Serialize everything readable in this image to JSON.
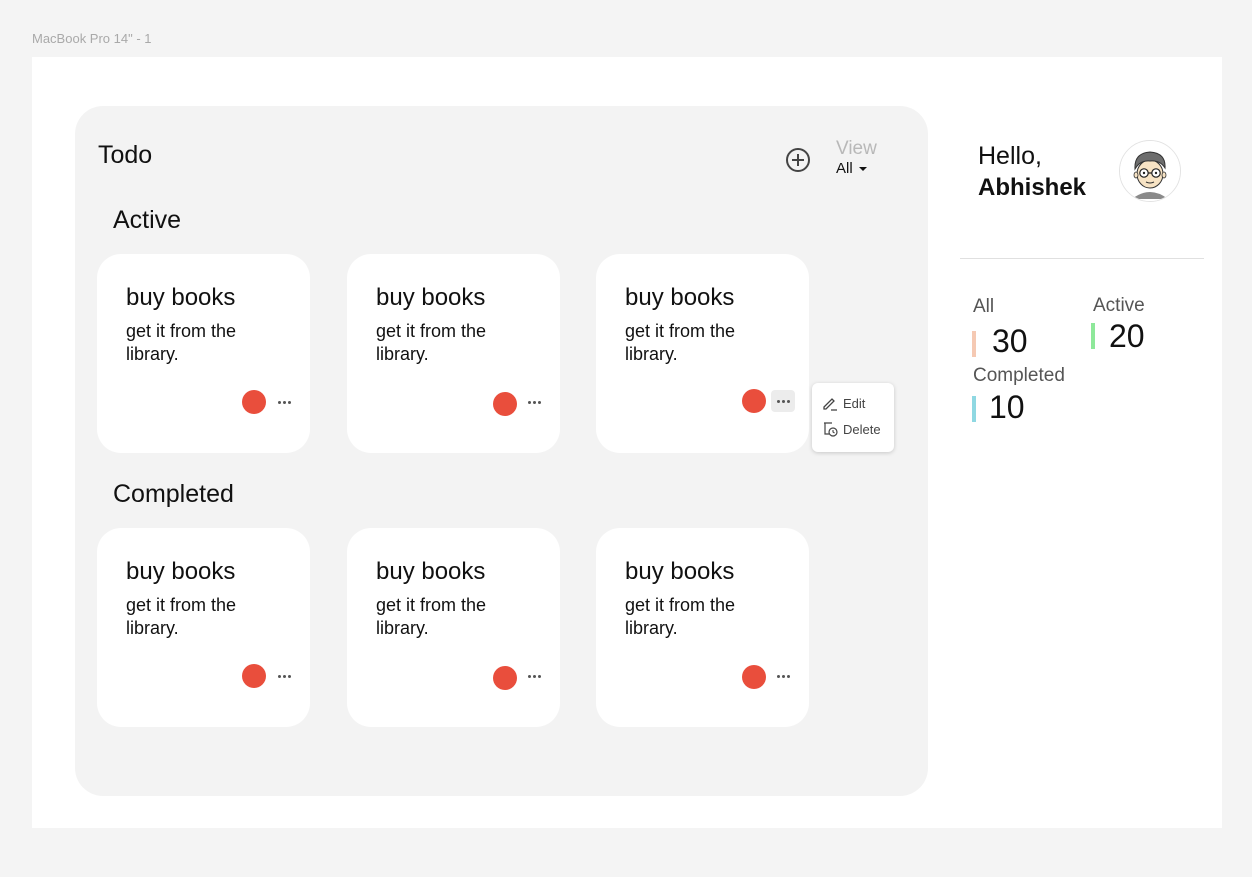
{
  "frame_label": "MacBook Pro 14\" - 1",
  "todo": {
    "title": "Todo",
    "view_label": "View",
    "view_value": "All",
    "sections": [
      {
        "title": "Active",
        "cards": [
          {
            "title": "buy books",
            "desc": "get it from the library."
          },
          {
            "title": "buy books",
            "desc": "get it from the library."
          },
          {
            "title": "buy books",
            "desc": "get it from the library."
          }
        ]
      },
      {
        "title": "Completed",
        "cards": [
          {
            "title": "buy books",
            "desc": "get it from the library."
          },
          {
            "title": "buy books",
            "desc": "get it from the library."
          },
          {
            "title": "buy books",
            "desc": "get it from the library."
          }
        ]
      }
    ],
    "context_menu": {
      "edit": "Edit",
      "delete": "Delete"
    }
  },
  "profile": {
    "greeting": "Hello,",
    "name": "Abhishek"
  },
  "stats": {
    "all": {
      "label": "All",
      "value": "30",
      "color": "#f5c9b3"
    },
    "active": {
      "label": "Active",
      "value": "20",
      "color": "#8ee89a"
    },
    "completed": {
      "label": "Completed",
      "value": "10",
      "color": "#8fd8e2"
    }
  },
  "colors": {
    "status_dot": "#e94e3c",
    "board_bg": "#f3f3f3"
  }
}
